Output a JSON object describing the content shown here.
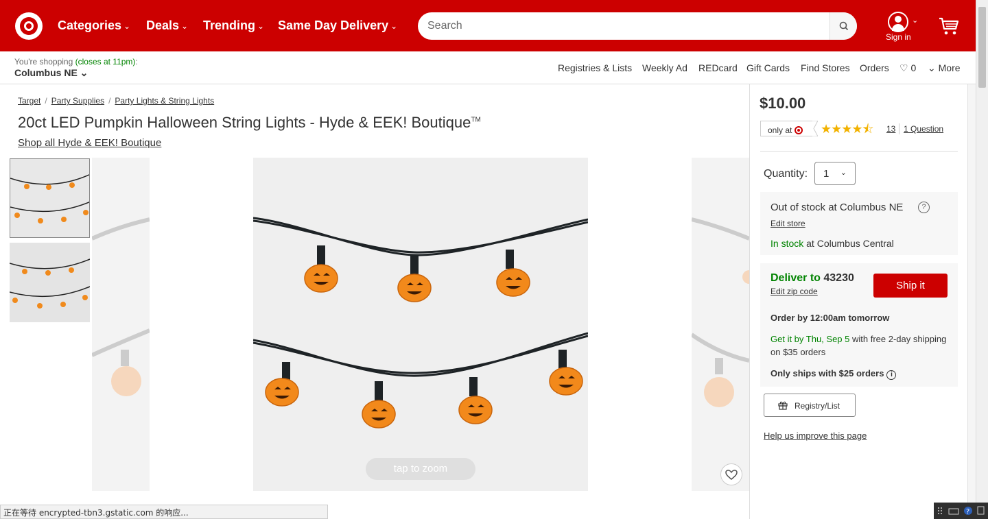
{
  "header": {
    "nav": [
      {
        "label": "Categories"
      },
      {
        "label": "Deals"
      },
      {
        "label": "Trending"
      },
      {
        "label": "Same Day Delivery"
      }
    ],
    "search_placeholder": "Search",
    "signin_label": "Sign in"
  },
  "utility": {
    "shopping_prefix": "You're shopping",
    "closes": "(closes at 11pm)",
    "colon": ":",
    "store_name": "Columbus NE",
    "links": [
      "Registries & Lists",
      "Weekly Ad",
      "REDcard",
      "Gift Cards",
      "Find Stores",
      "Orders"
    ],
    "favorites_count": "0",
    "more_label": "More"
  },
  "breadcrumb": [
    "Target",
    "Party Supplies",
    "Party Lights & String Lights"
  ],
  "product": {
    "title": "20ct LED Pumpkin Halloween String Lights - Hyde & EEK! Boutique",
    "trademark": "TM",
    "brand_link": "Shop all Hyde & EEK! Boutique",
    "zoom_label": "tap to zoom"
  },
  "purchase": {
    "price": "$10.00",
    "only_at": "only at",
    "rating": 4.5,
    "stars": "★★★★⯪",
    "review_count": "13",
    "question_link": "1 Question",
    "quantity_label": "Quantity:",
    "quantity_value": "1",
    "out_of_stock": "Out of stock at Columbus NE",
    "edit_store": "Edit store",
    "in_stock": "In stock",
    "in_stock_at": " at Columbus Central",
    "deliver_to": "Deliver to",
    "zip": " 43230",
    "edit_zip": "Edit zip code",
    "ship_button": "Ship it",
    "order_by": "Order by 12:00am tomorrow",
    "get_it": "Get it by Thu, Sep 5",
    "get_it_rest": " with free 2-day shipping on $35 orders",
    "only_ships": "Only ships with $25 orders",
    "registry_button": "Registry/List",
    "help_link": "Help us improve this page"
  },
  "status_bar": "正在等待 encrypted-tbn3.gstatic.com 的响应...",
  "colors": {
    "brand": "#cc0000",
    "in_stock": "#008300",
    "stars": "#f2b200"
  }
}
